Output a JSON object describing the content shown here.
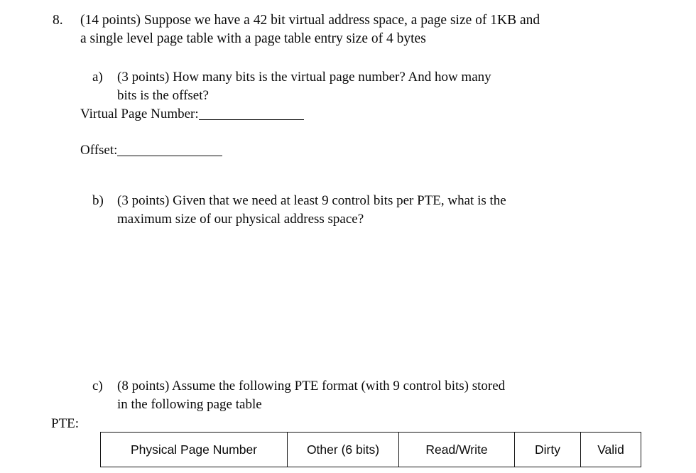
{
  "question": {
    "number": "8.",
    "text_line1": "(14 points) Suppose we have a 42 bit virtual address space, a page size of 1KB and",
    "text_line2": "a single level page table with a page table entry size of 4 bytes"
  },
  "subparts": [
    {
      "letter": "a)",
      "line1": "(3 points) How many bits is the virtual page number? And how many",
      "line2": "bits is the offset?"
    },
    {
      "letter": "b)",
      "line1": "(3 points) Given that we need at least 9 control bits per PTE, what is the",
      "line2": "maximum size of our physical address space?"
    },
    {
      "letter": "c)",
      "line1": "(8 points) Assume the following PTE format (with 9 control bits) stored",
      "line2": "in the following page table"
    }
  ],
  "blanks": [
    {
      "label": "Virtual Page Number:",
      "value": ""
    },
    {
      "label": "Offset:",
      "value": ""
    }
  ],
  "pte": {
    "label": "PTE:",
    "fields": [
      "Physical Page Number",
      "Other (6 bits)",
      "Read/Write",
      "Dirty",
      "Valid"
    ]
  }
}
